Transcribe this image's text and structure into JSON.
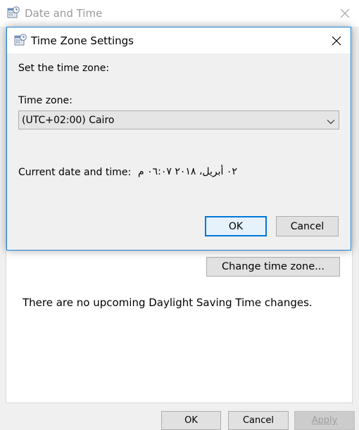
{
  "parent": {
    "title": "Date and Time",
    "change_tz_button": "Change time zone...",
    "dst_message": "There are no upcoming Daylight Saving Time changes.",
    "buttons": {
      "ok": "OK",
      "cancel": "Cancel",
      "apply": "Apply"
    }
  },
  "dialog": {
    "title": "Time Zone Settings",
    "set_label": "Set the time zone:",
    "tz_label": "Time zone:",
    "tz_value": "(UTC+02:00) Cairo",
    "current_label": "Current date and time:",
    "current_value": "٠٢ أبريل، ٢٠١٨ ٠٦:٠٧ م",
    "ok": "OK",
    "cancel": "Cancel"
  },
  "icons": {
    "app": "calendar-clock-icon",
    "close": "close-icon",
    "dropdown": "chevron-down-icon"
  },
  "colors": {
    "accent": "#0078d7",
    "dialog_border": "#1883d7",
    "disabled_text": "#a0a0a0"
  }
}
